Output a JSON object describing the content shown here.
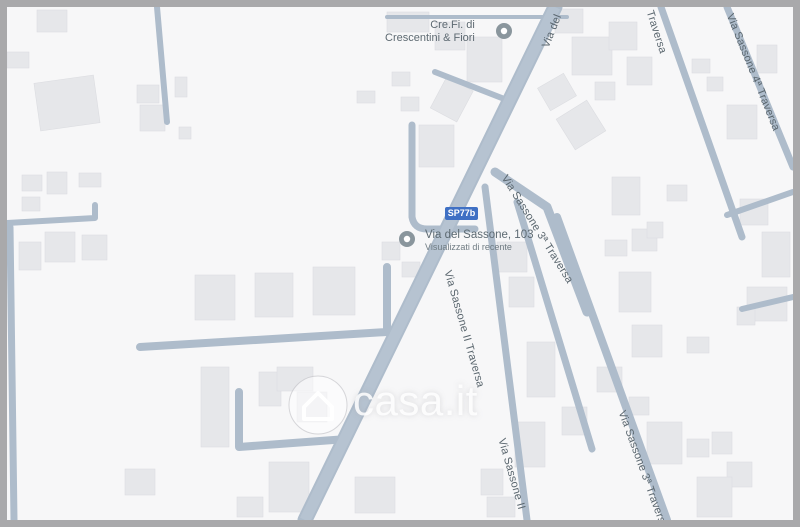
{
  "map": {
    "poi_1": {
      "name_line1": "Cre.Fi. di",
      "name_line2": "Crescentini & Fiori",
      "icon": "location-pin-icon"
    },
    "poi_2": {
      "name": "Via del Sassone, 103",
      "subtitle": "Visualizzati di recente",
      "icon": "location-pin-icon"
    },
    "route_shield": {
      "label": "SP77b",
      "color": "#3f70c4"
    },
    "streets": {
      "via_del_top": "Via del",
      "traversa_3": "Via Sassone 3ª Traversa",
      "traversa_2": "Via Sassone II Traversa",
      "traversa_2_bottom": "Via Sassone II",
      "traversa_3_bottom": "Via Sassone 3ª Traversa",
      "traversa_4": "Via Sassone 4ª Traversa",
      "traversa_5": "Traversa"
    },
    "watermark": {
      "text": "casa.it",
      "icon": "house-logo-icon"
    },
    "colors": {
      "background": "#f7f7f8",
      "road": "#aebccb",
      "building": "#e6e7ea",
      "frame": "#a9a9ab"
    }
  }
}
